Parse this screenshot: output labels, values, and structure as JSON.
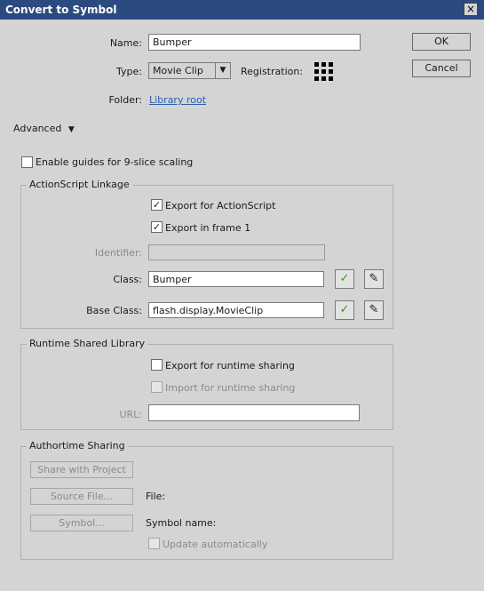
{
  "window": {
    "title": "Convert to Symbol",
    "close_glyph": "×"
  },
  "general": {
    "name_label": "Name:",
    "name_value": "Bumper",
    "type_label": "Type:",
    "type_value": "Movie Clip",
    "registration_label": "Registration:",
    "folder_label": "Folder:",
    "folder_value": "Library root",
    "advanced_label": "Advanced"
  },
  "buttons": {
    "ok": "OK",
    "cancel": "Cancel"
  },
  "scaling": {
    "label": "Enable guides for 9-slice scaling",
    "checked": false
  },
  "linkage": {
    "title": "ActionScript Linkage",
    "export_as": {
      "label": "Export for ActionScript",
      "checked": true
    },
    "export_frame1": {
      "label": "Export in frame 1",
      "checked": true
    },
    "identifier_label": "Identifier:",
    "identifier_value": "",
    "class_label": "Class:",
    "class_value": "Bumper",
    "base_class_label": "Base Class:",
    "base_class_value": "flash.display.MovieClip"
  },
  "rsl": {
    "title": "Runtime Shared Library",
    "export_runtime": {
      "label": "Export for runtime sharing",
      "checked": false
    },
    "import_runtime": {
      "label": "Import for runtime sharing",
      "checked": false
    },
    "url_label": "URL:",
    "url_value": ""
  },
  "authortime": {
    "title": "Authortime Sharing",
    "share_button": "Share with Project",
    "source_button": "Source File...",
    "file_label": "File:",
    "symbol_button": "Symbol...",
    "symbol_name_label": "Symbol name:",
    "update_auto": {
      "label": "Update automatically",
      "checked": false
    }
  },
  "icons": {
    "validate": "check-icon",
    "edit": "pencil-icon",
    "dropdown": "triangle-down-icon"
  },
  "colors": {
    "titlebar": "#2b4a80",
    "link": "#2a5db0",
    "check": "#3a8f22"
  }
}
